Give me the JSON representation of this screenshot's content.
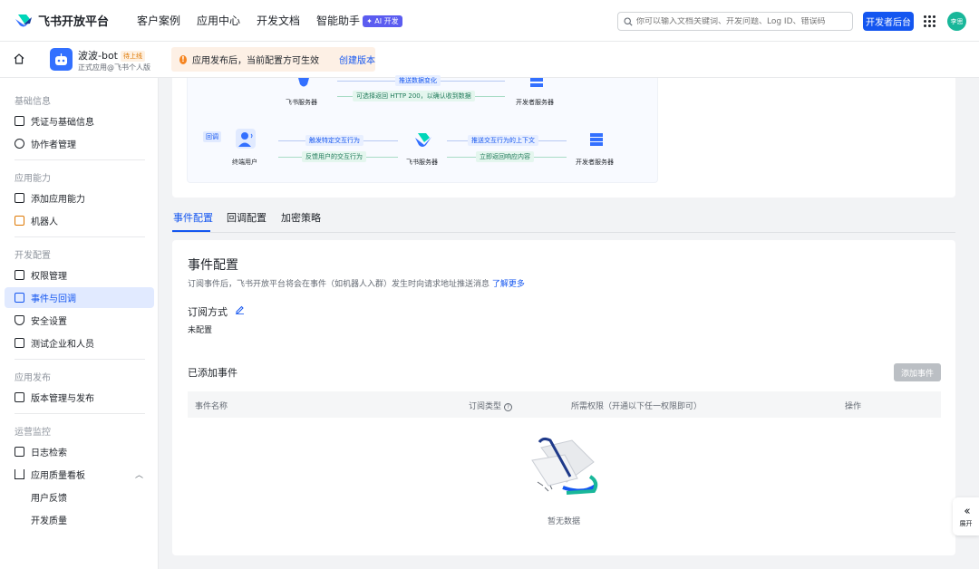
{
  "brand": {
    "name": "飞书开放平台"
  },
  "nav": {
    "links": [
      "客户案例",
      "应用中心",
      "开发文档",
      "智能助手"
    ],
    "ai_badge": "✦ AI 开发"
  },
  "search": {
    "placeholder": "你可以输入文档关键词、开发问题、Log ID、错误码"
  },
  "header": {
    "dev_console": "开发者后台",
    "avatar_text": "李思"
  },
  "app": {
    "name": "波波-bot",
    "status": "待上线",
    "subtitle": "正式应用@飞书个人版"
  },
  "notice": {
    "text": "应用发布后，当前配置方可生效",
    "link": "创建版本"
  },
  "sidebar": {
    "sections": [
      {
        "title": "基础信息",
        "items": [
          "凭证与基础信息",
          "协作者管理"
        ]
      },
      {
        "title": "应用能力",
        "items": [
          "添加应用能力",
          "机器人"
        ]
      },
      {
        "title": "开发配置",
        "items": [
          "权限管理",
          "事件与回调",
          "安全设置",
          "测试企业和人员"
        ]
      },
      {
        "title": "应用发布",
        "items": [
          "版本管理与发布"
        ]
      },
      {
        "title": "运营监控",
        "items": [
          "日志检索",
          "应用质量看板"
        ]
      }
    ],
    "sub_items": [
      "用户反馈",
      "开发质量"
    ],
    "active": "事件与回调"
  },
  "diagram": {
    "top_pill_1": "推送数据变化",
    "top_pill_2": "可选择返回 HTTP 200，以确认收到数据",
    "top_left_label": "飞书服务器",
    "top_right_label": "开发者服务器",
    "callback_tag": "回调",
    "end_user": "终端用户",
    "server": "飞书服务器",
    "dev_server": "开发者服务器",
    "pill_trigger": "触发特定交互行为",
    "pill_feedback": "反馈用户的交互行为",
    "pill_push": "推送交互行为的上下文",
    "pill_return": "立即返回响应内容"
  },
  "tabs": [
    "事件配置",
    "回调配置",
    "加密策略"
  ],
  "event_config": {
    "title": "事件配置",
    "desc": "订阅事件后，飞书开放平台将会在事件（如机器人入群）发生时向请求地址推送消息",
    "learn_more": "了解更多",
    "subscription_label": "订阅方式",
    "subscription_value": "未配置",
    "added_label": "已添加事件",
    "add_button": "添加事件",
    "columns": [
      "事件名称",
      "订阅类型",
      "所需权限（开通以下任一权限即可）",
      "操作"
    ],
    "empty_text": "暂无数据"
  },
  "expand": {
    "label": "展开"
  },
  "colors": {
    "accent": "#1456f0",
    "active_bg": "#e1eaff",
    "avatar": "#19b79a"
  }
}
